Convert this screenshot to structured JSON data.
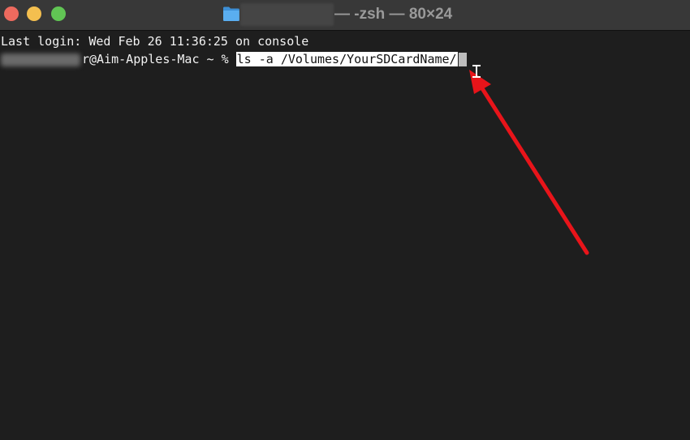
{
  "window": {
    "title_suffix": "— -zsh — 80×24",
    "icon": "folder-icon"
  },
  "terminal": {
    "last_login": "Last login: Wed Feb 26 11:36:25 on console",
    "prompt": "r@Aim-Apples-Mac ~ % ",
    "command": "ls -a /Volumes/YourSDCardName/"
  },
  "colors": {
    "background": "#1e1e1e",
    "titlebar": "#383838",
    "close": "#ed6a5e",
    "minimize": "#f4bf4f",
    "maximize": "#61c554",
    "annotation_arrow": "#e8141a"
  }
}
